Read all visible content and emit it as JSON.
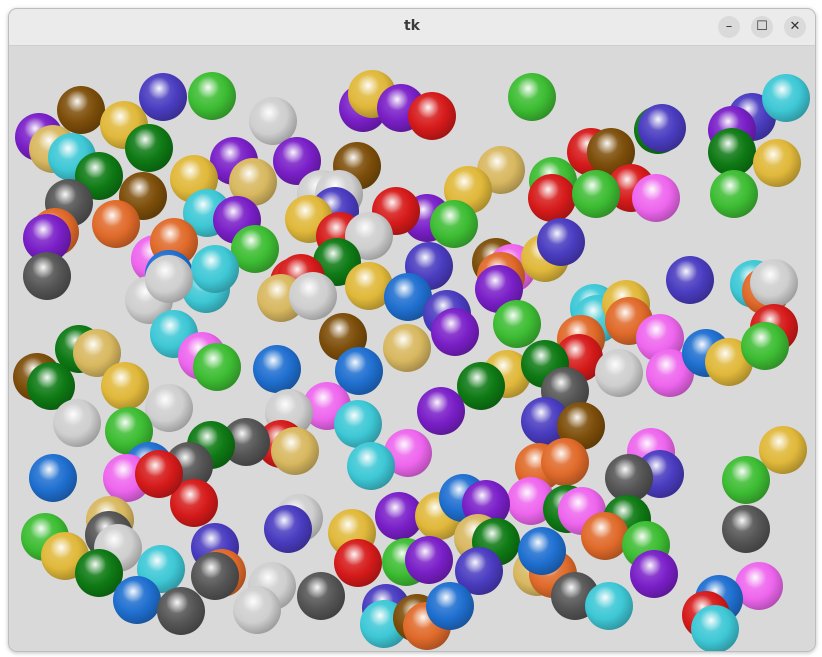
{
  "window": {
    "title": "tk",
    "minimize_glyph": "–",
    "maximize_glyph": "☐",
    "close_glyph": "✕"
  },
  "balls": {
    "colors": {
      "purple": "#7a1fc8",
      "brown": "#7d4e0a",
      "gold": "#e0b83a",
      "navy": "#4a3cc0",
      "green": "#3dbd33",
      "silver": "#cfcfcf",
      "red": "#d61a1a",
      "darkgreen": "#0e7a14",
      "cyan": "#3ec8d6",
      "khaki": "#d8b860",
      "charcoal": "#555555",
      "orange": "#e06a2a",
      "pink": "#ee66ee",
      "blue": "#1f6fd0"
    }
  }
}
